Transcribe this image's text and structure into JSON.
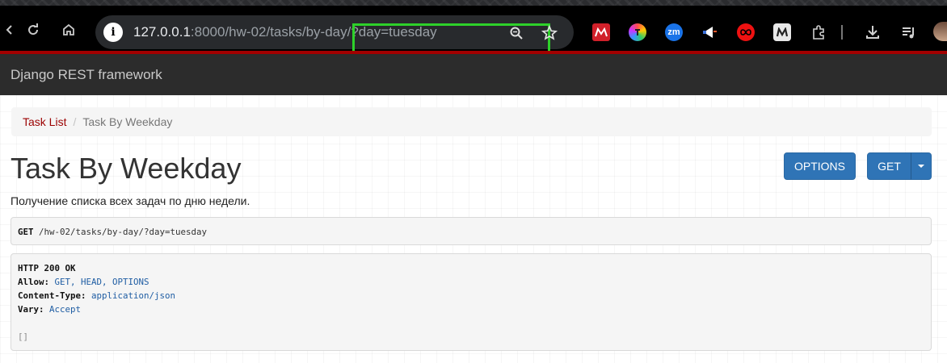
{
  "browser": {
    "url_host": "127.0.0.1",
    "url_rest": ":8000/hw-02/tasks/by-day/?day=tuesday",
    "colors": {
      "highlight": "#2ed12a",
      "accent_strip": "#a30000"
    },
    "icons": [
      "back-icon",
      "reload-icon",
      "home-icon",
      "site-info-icon",
      "zoom-icon",
      "bookmark-star-icon",
      "extensions-icon",
      "download-icon",
      "reading-list-icon",
      "avatar"
    ],
    "ext_labels": {
      "zoom": "zm"
    }
  },
  "navbar": {
    "brand": "Django REST framework"
  },
  "breadcrumb": {
    "items": [
      {
        "label": "Task List"
      },
      {
        "label": "Task By Weekday"
      }
    ],
    "separator": "/"
  },
  "page": {
    "title": "Task By Weekday",
    "description": "Получение списка всех задач по дню недели.",
    "buttons": {
      "options": "OPTIONS",
      "get": "GET"
    }
  },
  "request": {
    "method": "GET",
    "path": "/hw-02/tasks/by-day/?day=tuesday"
  },
  "response": {
    "status": "HTTP 200 OK",
    "headers": [
      {
        "name": "Allow:",
        "value": "GET, HEAD, OPTIONS"
      },
      {
        "name": "Content-Type:",
        "value": "application/json"
      },
      {
        "name": "Vary:",
        "value": "Accept"
      }
    ],
    "body": "[]"
  }
}
